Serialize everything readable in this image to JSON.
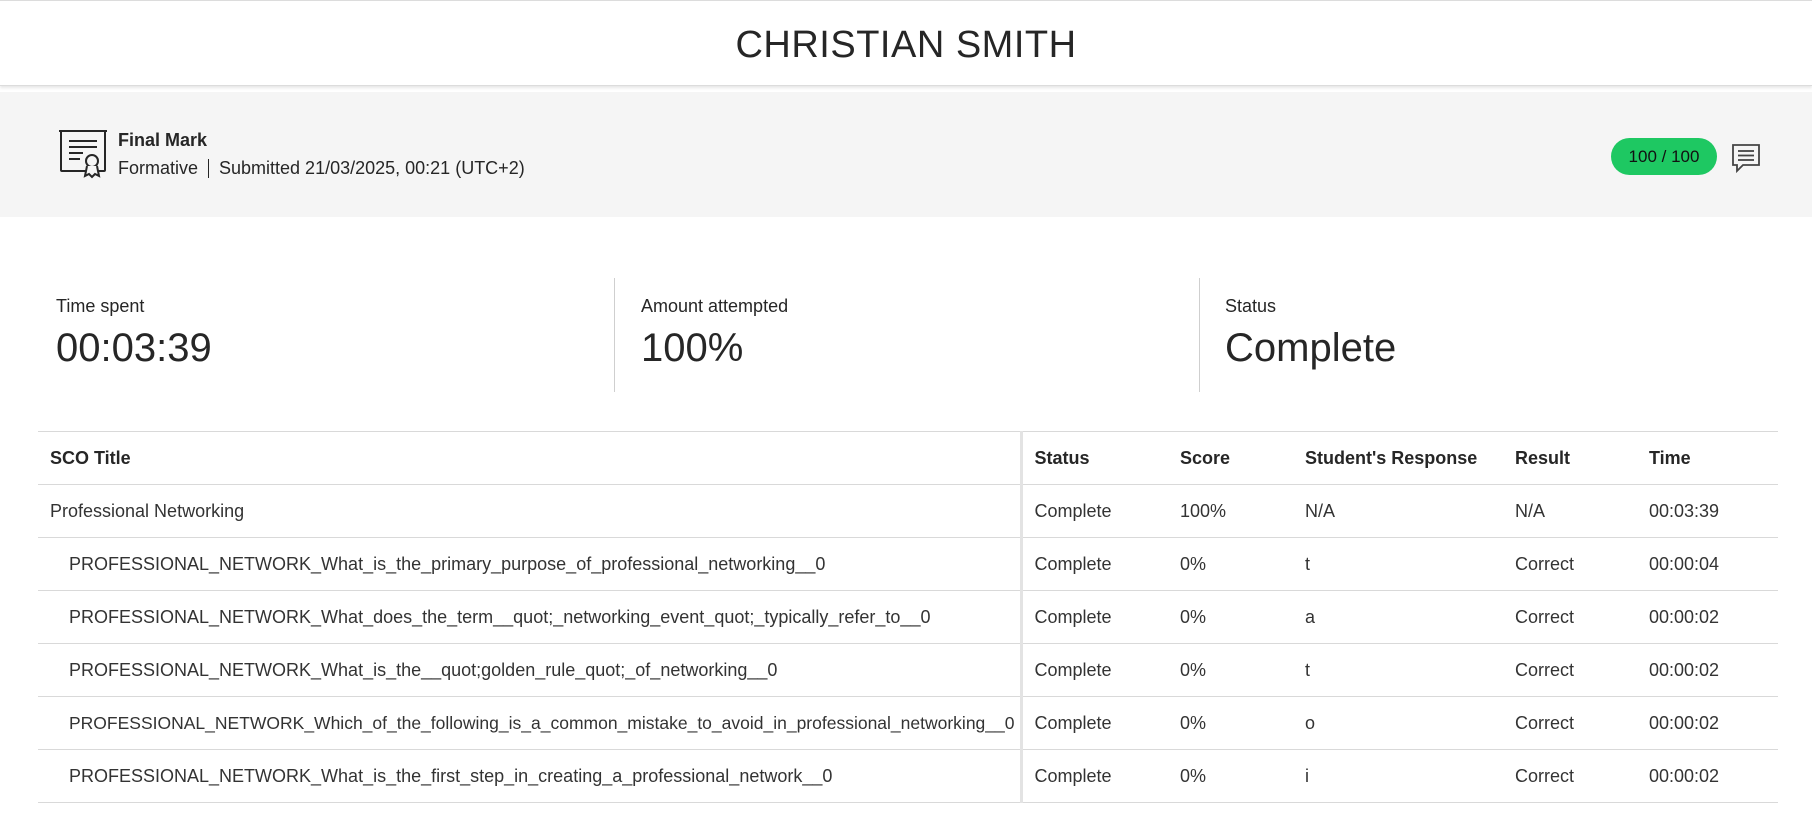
{
  "student": {
    "name": "CHRISTIAN SMITH"
  },
  "mark": {
    "title": "Final Mark",
    "type": "Formative",
    "submitted": "Submitted 21/03/2025, 00:21 (UTC+2)",
    "score": "100 / 100",
    "score_color": "#1ec862",
    "icon": "certificate-icon",
    "comment_icon": "comment-icon"
  },
  "stats": [
    {
      "label": "Time spent",
      "value": "00:03:39"
    },
    {
      "label": "Amount attempted",
      "value": "100%"
    },
    {
      "label": "Status",
      "value": "Complete"
    }
  ],
  "table": {
    "columns": [
      "SCO Title",
      "Status",
      "Score",
      "Student's Response",
      "Result",
      "Time"
    ],
    "rows": [
      {
        "title": "Professional Networking",
        "status": "Complete",
        "score": "100%",
        "response": "N/A",
        "result": "N/A",
        "time": "00:03:39"
      },
      {
        "title": "PROFESSIONAL_NETWORK_What_is_the_primary_purpose_of_professional_networking__0",
        "status": "Complete",
        "score": "0%",
        "response": "t",
        "result": "Correct",
        "time": "00:00:04"
      },
      {
        "title": "PROFESSIONAL_NETWORK_What_does_the_term__quot;_networking_event_quot;_typically_refer_to__0",
        "status": "Complete",
        "score": "0%",
        "response": "a",
        "result": "Correct",
        "time": "00:00:02"
      },
      {
        "title": "PROFESSIONAL_NETWORK_What_is_the__quot;golden_rule_quot;_of_networking__0",
        "status": "Complete",
        "score": "0%",
        "response": "t",
        "result": "Correct",
        "time": "00:00:02"
      },
      {
        "title": "PROFESSIONAL_NETWORK_Which_of_the_following_is_a_common_mistake_to_avoid_in_professional_networking__0",
        "status": "Complete",
        "score": "0%",
        "response": "o",
        "result": "Correct",
        "time": "00:00:02"
      },
      {
        "title": "PROFESSIONAL_NETWORK_What_is_the_first_step_in_creating_a_professional_network__0",
        "status": "Complete",
        "score": "0%",
        "response": "i",
        "result": "Correct",
        "time": "00:00:02"
      }
    ]
  }
}
